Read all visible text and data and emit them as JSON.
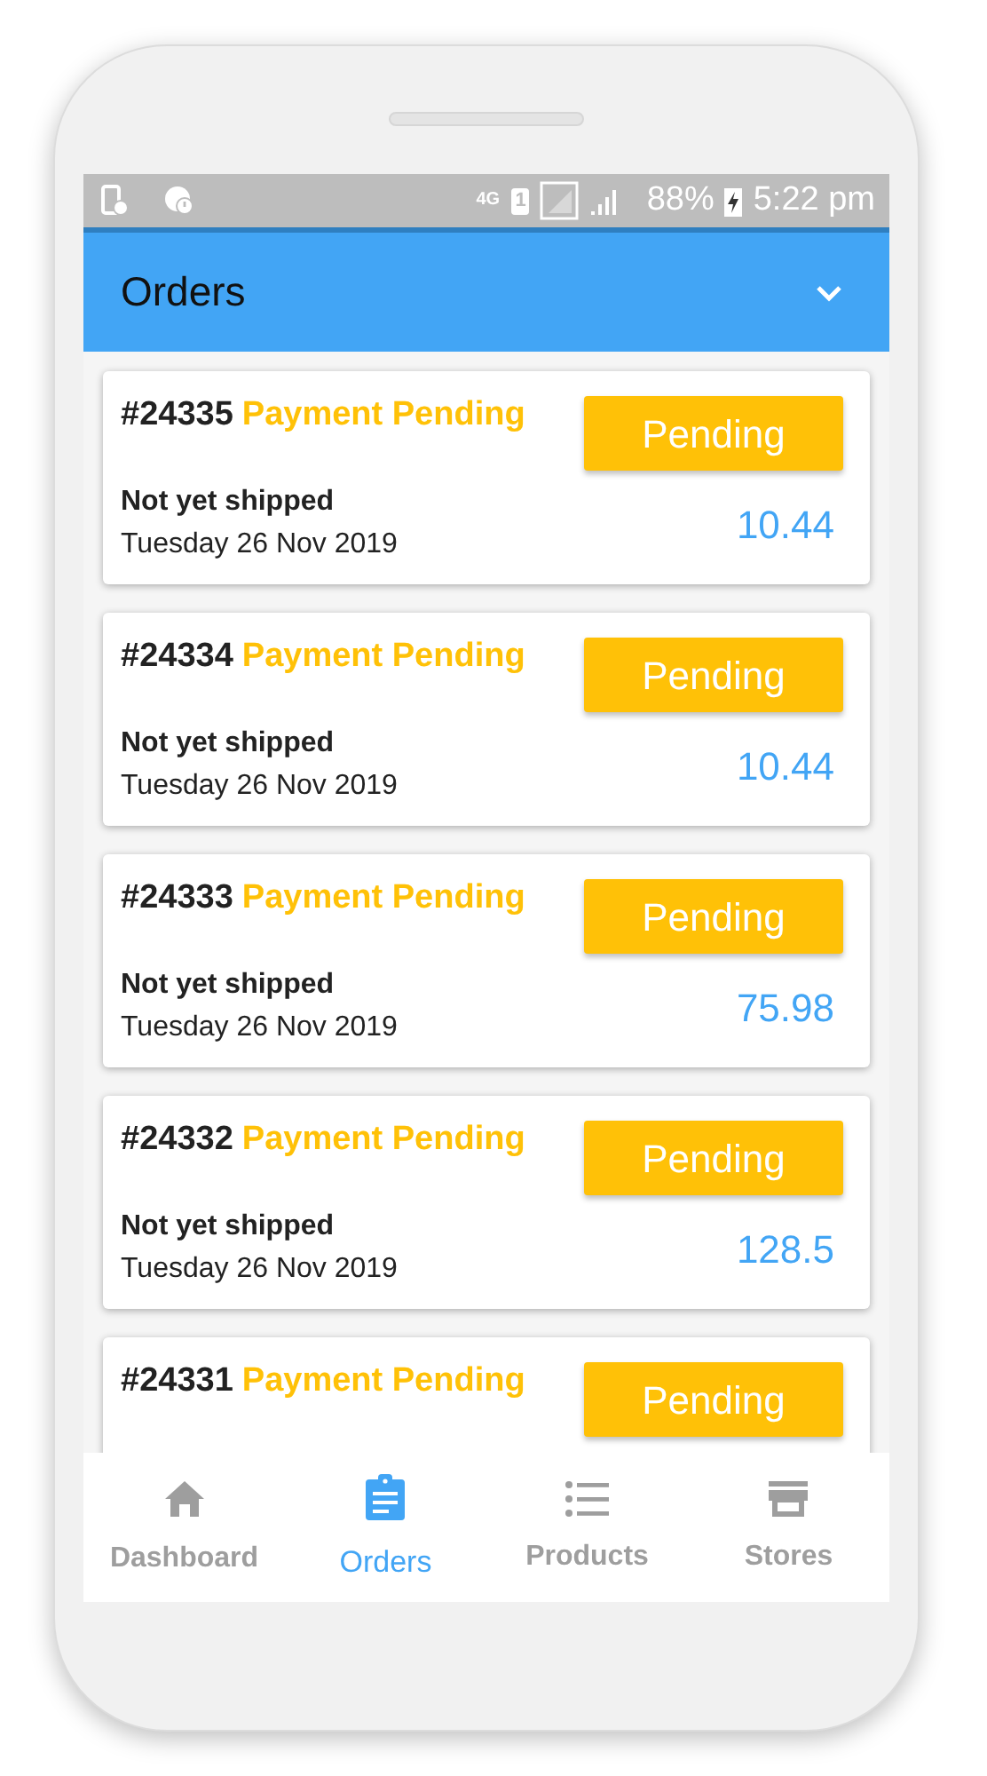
{
  "status_bar": {
    "network": "4G",
    "sim": "1",
    "battery": "88%",
    "time": "5:22 pm"
  },
  "app_bar": {
    "title": "Orders"
  },
  "orders": [
    {
      "number": "#24335",
      "status": "Payment Pending",
      "badge": "Pending",
      "shipping": "Not yet shipped",
      "date": "Tuesday 26 Nov 2019",
      "amount": "10.44"
    },
    {
      "number": "#24334",
      "status": "Payment Pending",
      "badge": "Pending",
      "shipping": "Not yet shipped",
      "date": "Tuesday 26 Nov 2019",
      "amount": "10.44"
    },
    {
      "number": "#24333",
      "status": "Payment Pending",
      "badge": "Pending",
      "shipping": "Not yet shipped",
      "date": "Tuesday 26 Nov 2019",
      "amount": "75.98"
    },
    {
      "number": "#24332",
      "status": "Payment Pending",
      "badge": "Pending",
      "shipping": "Not yet shipped",
      "date": "Tuesday 26 Nov 2019",
      "amount": "128.5"
    },
    {
      "number": "#24331",
      "status": "Payment Pending",
      "badge": "Pending"
    }
  ],
  "bottom_nav": [
    {
      "kind": "home",
      "label": "Dashboard",
      "selected": false
    },
    {
      "kind": "clipboard",
      "label": "Orders",
      "selected": true
    },
    {
      "kind": "list",
      "label": "Products",
      "selected": false
    },
    {
      "kind": "store",
      "label": "Stores",
      "selected": false
    }
  ]
}
